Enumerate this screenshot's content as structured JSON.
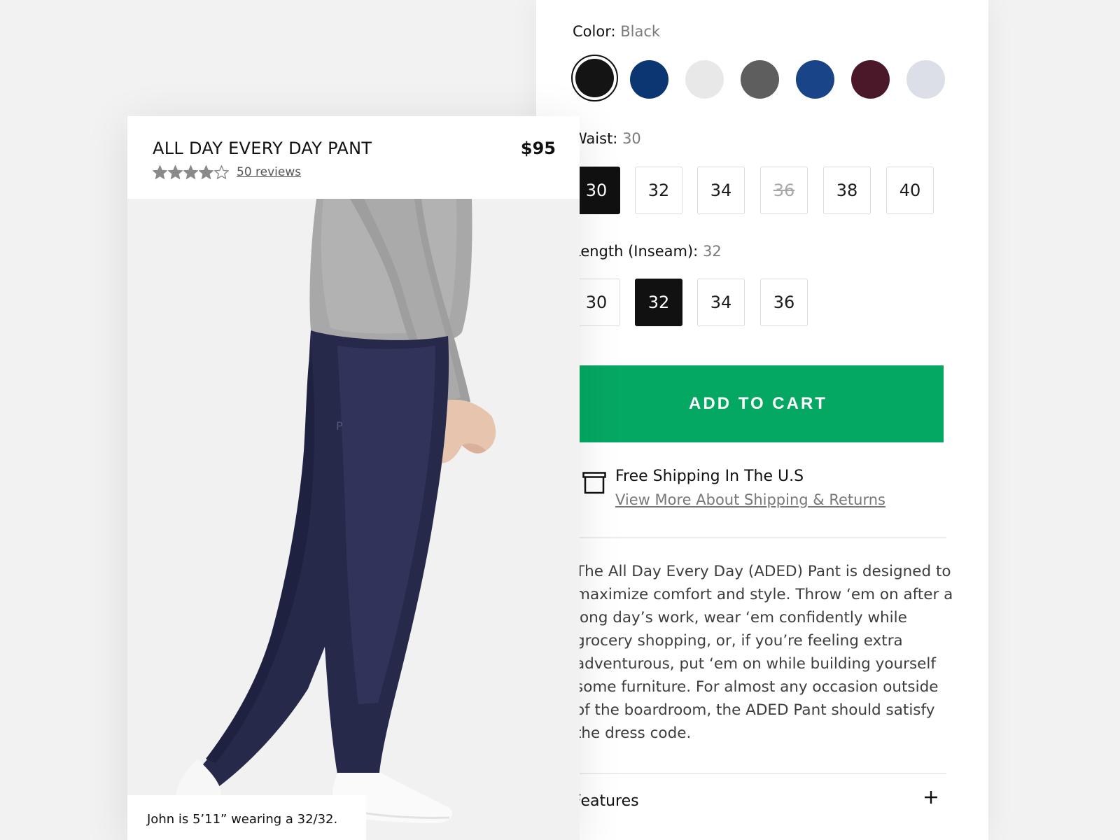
{
  "colors": {
    "accent_green": "#05a863",
    "swatches": [
      "#141414",
      "#0b3672",
      "#e8e8e8",
      "#5e5e5e",
      "#1a4488",
      "#4a1828",
      "#dcdfe8"
    ]
  },
  "color_option": {
    "label": "Color:",
    "value": "Black"
  },
  "waist_option": {
    "label": "Waist:",
    "value": "30",
    "sizes": [
      {
        "label": "30",
        "state": "selected"
      },
      {
        "label": "32",
        "state": "available"
      },
      {
        "label": "34",
        "state": "available"
      },
      {
        "label": "36",
        "state": "unavailable"
      },
      {
        "label": "38",
        "state": "available"
      },
      {
        "label": "40",
        "state": "available"
      }
    ]
  },
  "length_option": {
    "label": "Length (Inseam):",
    "value": "32",
    "sizes": [
      {
        "label": "30",
        "state": "available"
      },
      {
        "label": "32",
        "state": "selected"
      },
      {
        "label": "34",
        "state": "available"
      },
      {
        "label": "36",
        "state": "available"
      }
    ]
  },
  "cart": {
    "label": "ADD TO CART"
  },
  "shipping": {
    "icon": "box-icon",
    "title": "Free Shipping In The U.S",
    "link": "View More About Shipping & Returns"
  },
  "description": "The All Day Every Day (ADED) Pant is designed to maximize comfort and style. Throw ‘em on after a long day’s work, wear ‘em confidently while grocery shopping, or, if you’re feeling extra adventurous, put ‘em on while building yourself some furniture. For almost any occasion outside of the boardroom, the ADED Pant should satisfy the dress code.",
  "features": {
    "label": "Features",
    "icon": "plus-icon"
  },
  "product": {
    "title": "ALL DAY EVERY DAY PANT",
    "price": "$95",
    "rating": 4,
    "rating_max": 5,
    "reviews": "50 reviews"
  },
  "model_caption": "John is 5’11” wearing a 32/32."
}
